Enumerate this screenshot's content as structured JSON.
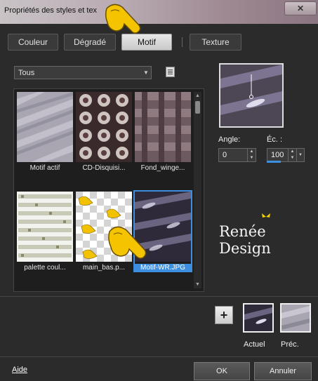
{
  "window": {
    "title": "Propriétés des styles et tex",
    "close_label": "✕"
  },
  "tabs": [
    {
      "label": "Couleur"
    },
    {
      "label": "Dégradé"
    },
    {
      "label": "Motif"
    },
    {
      "label": "Texture"
    }
  ],
  "active_tab": "Motif",
  "category_dropdown": {
    "value": "Tous"
  },
  "gallery": {
    "items": [
      {
        "caption": "Motif actif"
      },
      {
        "caption": "CD-Disquisi..."
      },
      {
        "caption": "Fond_winge..."
      },
      {
        "caption": "palette coul..."
      },
      {
        "caption": "main_bas.p..."
      },
      {
        "caption": "Motif-WR.JPG"
      }
    ],
    "selected": "Motif-WR.JPG"
  },
  "angle": {
    "label": "Angle:",
    "value": "0"
  },
  "scale": {
    "label": "Éc. :",
    "value": "100"
  },
  "brand": "Renée Design",
  "swatches": {
    "current_label": "Actuel",
    "previous_label": "Préc."
  },
  "footer": {
    "help_label": "Aide",
    "ok_label": "OK",
    "cancel_label": "Annuler"
  },
  "colors": {
    "accent": "#3c8fe0",
    "background": "#2b2b2b"
  }
}
